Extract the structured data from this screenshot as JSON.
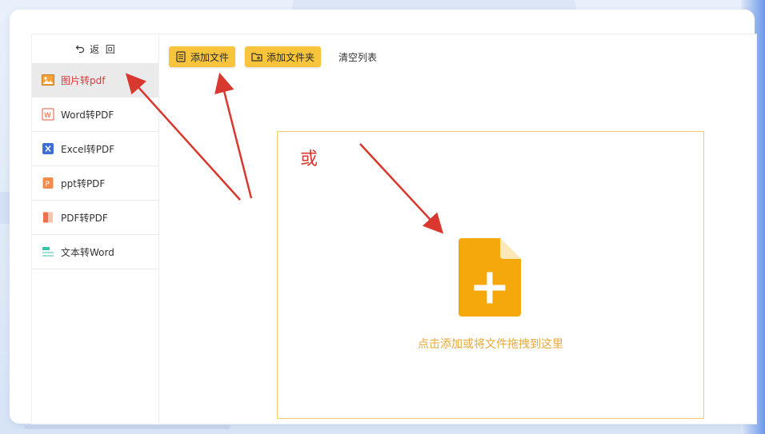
{
  "sidebar": {
    "back_label": "返  回",
    "items": [
      {
        "label": "图片转pdf",
        "icon": "image-icon",
        "active": true
      },
      {
        "label": "Word转PDF",
        "icon": "word-icon",
        "active": false
      },
      {
        "label": "Excel转PDF",
        "icon": "excel-icon",
        "active": false
      },
      {
        "label": "ppt转PDF",
        "icon": "ppt-icon",
        "active": false
      },
      {
        "label": "PDF转PDF",
        "icon": "pdf-icon",
        "active": false
      },
      {
        "label": "文本转Word",
        "icon": "text-icon",
        "active": false
      }
    ]
  },
  "toolbar": {
    "add_file": "添加文件",
    "add_folder": "添加文件夹",
    "clear_list": "清空列表"
  },
  "dropzone": {
    "or_label": "或",
    "hint": "点击添加或将文件拖拽到这里"
  },
  "colors": {
    "accent": "#f7c43b",
    "active_text": "#d9383a",
    "annotation": "#d8382e",
    "file_icon": "#f5a80c",
    "hint": "#e8a83a"
  }
}
